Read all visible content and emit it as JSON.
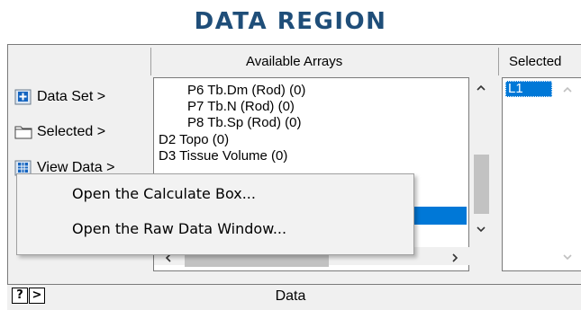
{
  "title": "DATA REGION",
  "colors": {
    "title": "#1f4e79",
    "selection": "#0078d7",
    "icon_blue": "#1565c0"
  },
  "headers": {
    "available": "Available Arrays",
    "selected": "Selected"
  },
  "side_buttons": [
    {
      "label": "Data Set >",
      "icon": "plus-icon"
    },
    {
      "label": "Selected >",
      "icon": "folder-icon"
    },
    {
      "label": "View Data >",
      "icon": "grid-icon"
    }
  ],
  "available_items": [
    "P6 Tb.Dm (Rod) (0)",
    "P7 Tb.N (Rod) (0)",
    "P8 Tb.Sp (Rod) (0)",
    "D2 Topo (0)",
    "D3 Tissue Volume (0)"
  ],
  "selected_items": [
    "L1"
  ],
  "context_menu": {
    "items": [
      "Open the Calculate Box...",
      "Open the Raw Data Window..."
    ]
  },
  "footer": {
    "help": "?",
    "next": ">",
    "label": "Data"
  }
}
